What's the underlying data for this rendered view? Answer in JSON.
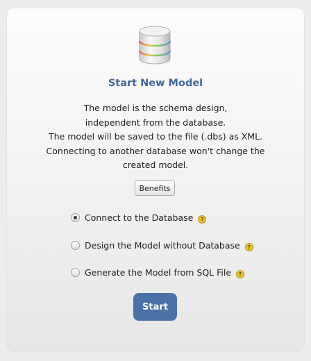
{
  "panel": {
    "icon": "database-icon",
    "title": "Start New Model",
    "description_lines": [
      "The model is the schema design,",
      "independent from the database.",
      "The model will be saved to the file (.dbs) as XML.",
      "Connecting to another database won't change the",
      "created model."
    ]
  },
  "benefits_button": {
    "label": "Benefits"
  },
  "options": [
    {
      "label": "Connect to the Database",
      "selected": true,
      "help_icon": "help-icon"
    },
    {
      "label": "Design the Model without Database",
      "selected": false,
      "help_icon": "help-icon"
    },
    {
      "label": "Generate the Model from SQL File",
      "selected": false,
      "help_icon": "help-icon"
    }
  ],
  "start_button": {
    "label": "Start"
  },
  "colors": {
    "accent": "#4a72a7",
    "title": "#3f6898",
    "help_badge": "#e6c232"
  }
}
